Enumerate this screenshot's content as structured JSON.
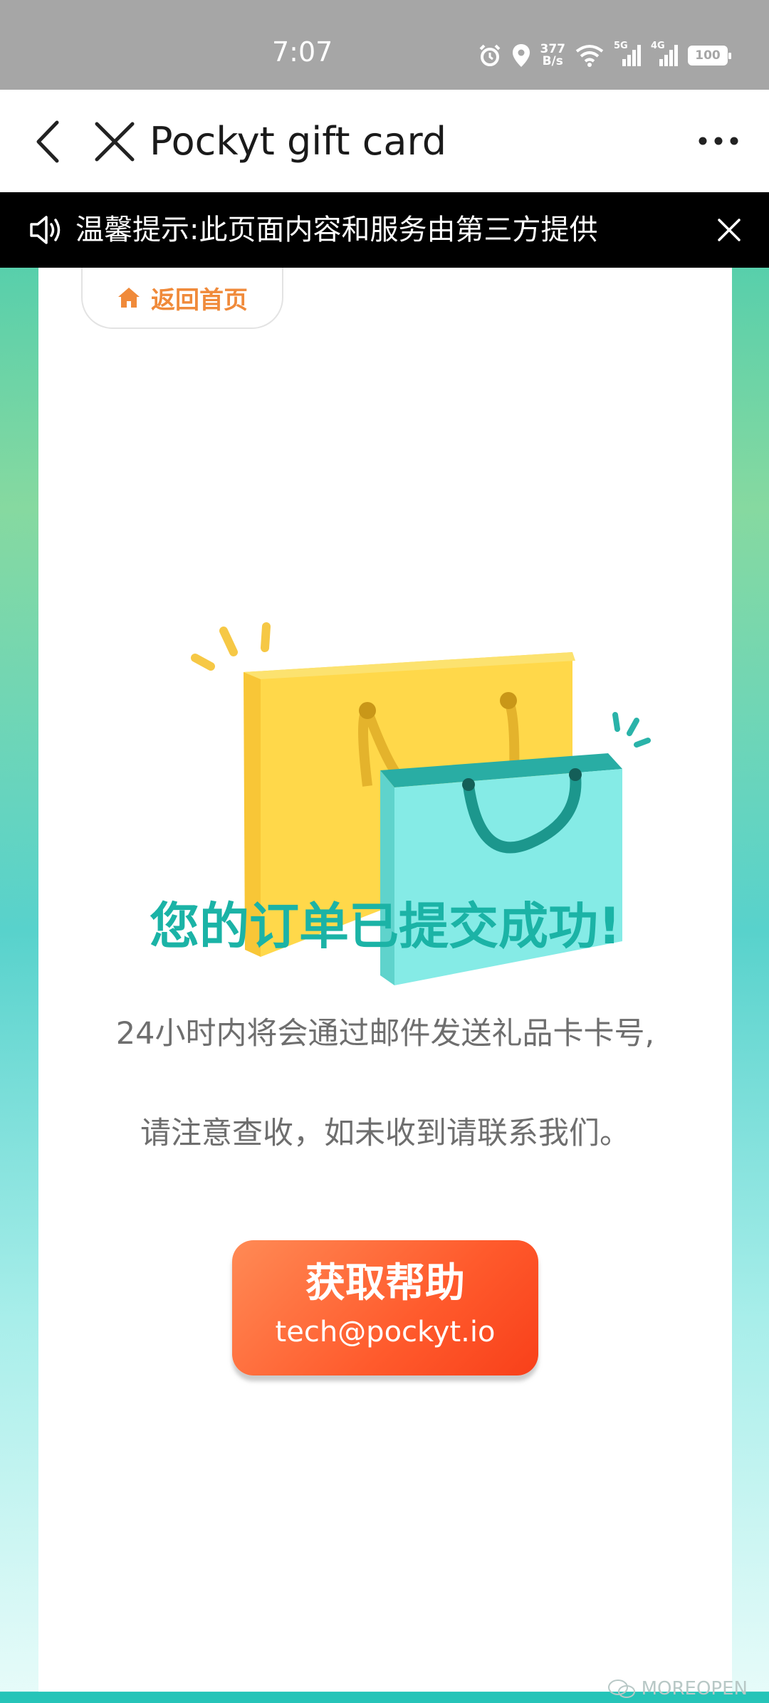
{
  "status_bar": {
    "time": "7:07",
    "net_speed_value": "377",
    "net_speed_unit": "B/s",
    "signal_1": "5G",
    "signal_2": "4G",
    "battery": "100"
  },
  "navbar": {
    "title": "Pockyt gift card"
  },
  "notice": {
    "text": "温馨提示:此页面内容和服务由第三方提供"
  },
  "page": {
    "home_button_label": "返回首页",
    "success_title": "您的订单已提交成功!",
    "desc_line1": "24小时内将会通过邮件发送礼品卡卡号,",
    "desc_line2": "请注意查收，如未收到请联系我们。",
    "help_label": "获取帮助",
    "help_email": "tech@pockyt.io"
  },
  "watermark": "MOREOPEN",
  "colors": {
    "accent": "#1bb3a6",
    "home_button": "#f08a3a",
    "help_button": "#ff5a2c"
  }
}
